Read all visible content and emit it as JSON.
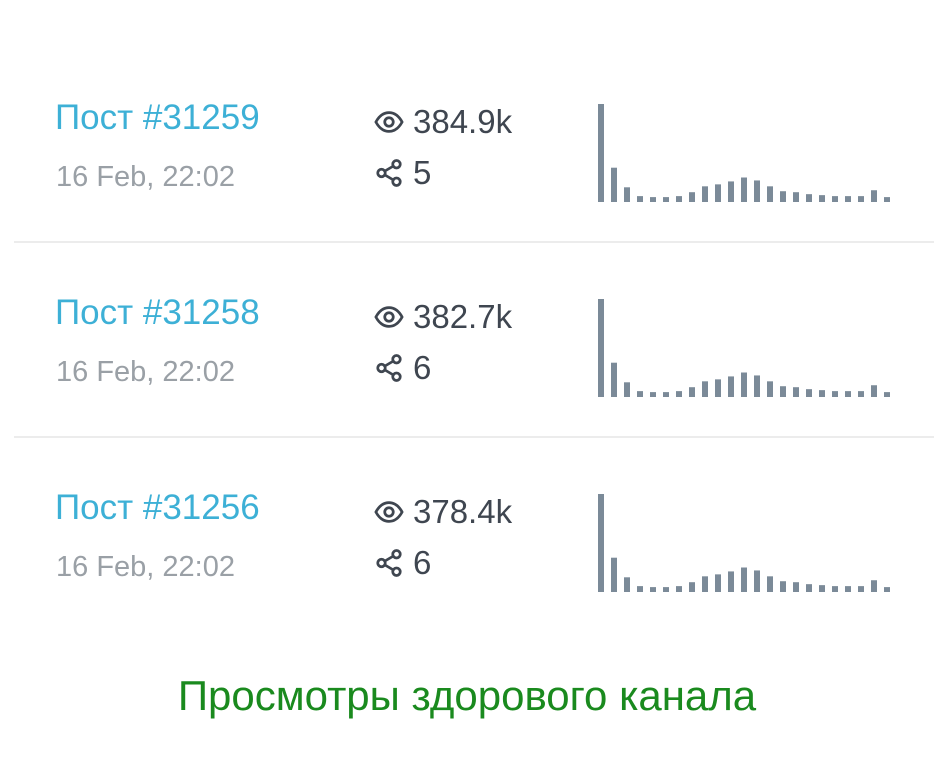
{
  "posts": [
    {
      "title": "Пост #31259",
      "date": "16 Feb, 22:02",
      "views": "384.9k",
      "shares": "5",
      "spark_values": [
        100,
        35,
        15,
        6,
        5,
        5,
        6,
        10,
        16,
        18,
        21,
        25,
        22,
        16,
        11,
        10,
        8,
        7,
        6,
        6,
        6,
        12,
        5
      ]
    },
    {
      "title": "Пост #31258",
      "date": "16 Feb, 22:02",
      "views": "382.7k",
      "shares": "6",
      "spark_values": [
        100,
        35,
        15,
        6,
        5,
        5,
        6,
        10,
        16,
        18,
        21,
        25,
        22,
        16,
        11,
        10,
        8,
        7,
        6,
        6,
        6,
        12,
        5
      ]
    },
    {
      "title": "Пост #31256",
      "date": "16 Feb, 22:02",
      "views": "378.4k",
      "shares": "6",
      "spark_values": [
        100,
        35,
        15,
        6,
        5,
        5,
        6,
        10,
        16,
        18,
        21,
        25,
        22,
        16,
        11,
        10,
        8,
        7,
        6,
        6,
        6,
        12,
        5
      ]
    }
  ],
  "icons": {
    "views": "eye-icon",
    "shares": "share-icon"
  },
  "colors": {
    "link": "#3db0d6",
    "date": "#9aa0a6",
    "stat": "#3f4650",
    "bar": "#7b8a98",
    "caption": "#1a8a1e"
  },
  "caption": "Просмотры здорового канала"
}
